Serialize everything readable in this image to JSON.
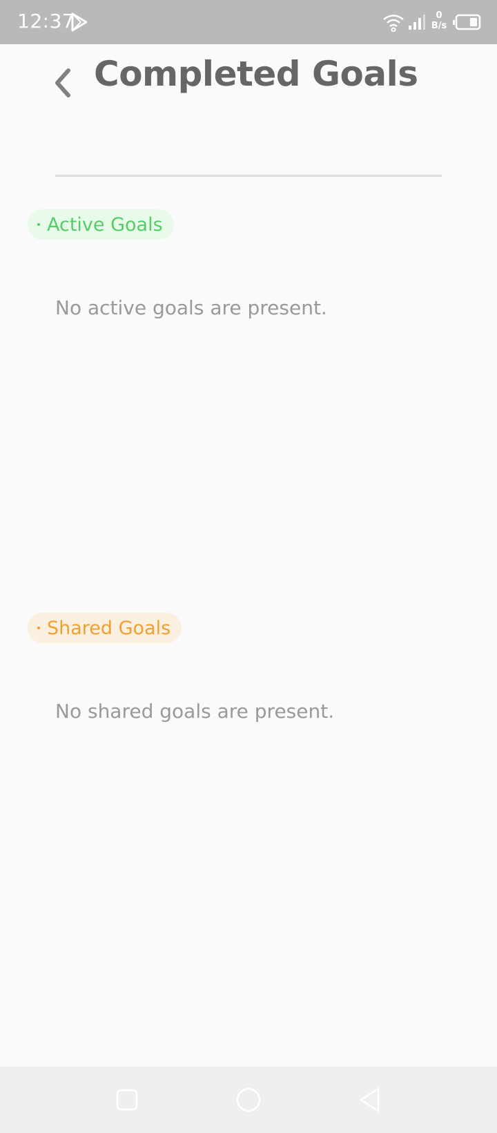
{
  "status_bar": {
    "time": "12:37",
    "net_speed_value": "0",
    "net_speed_unit": "B/s",
    "icons": [
      "play-store-icon",
      "wifi-icon",
      "signal-icon",
      "battery-icon"
    ]
  },
  "header": {
    "title": "Completed Goals",
    "back_icon": "chevron-left-icon"
  },
  "sections": {
    "active": {
      "label": "Active Goals",
      "empty_message": "No active goals are present.",
      "color": "#55cc66",
      "bg_color": "#e8fbea"
    },
    "shared": {
      "label": "Shared Goals",
      "empty_message": "No shared goals are present.",
      "color": "#f0a030",
      "bg_color": "#fbefe0"
    }
  },
  "nav_bar": {
    "icons": [
      "recent-apps-icon",
      "home-icon",
      "back-icon"
    ]
  }
}
